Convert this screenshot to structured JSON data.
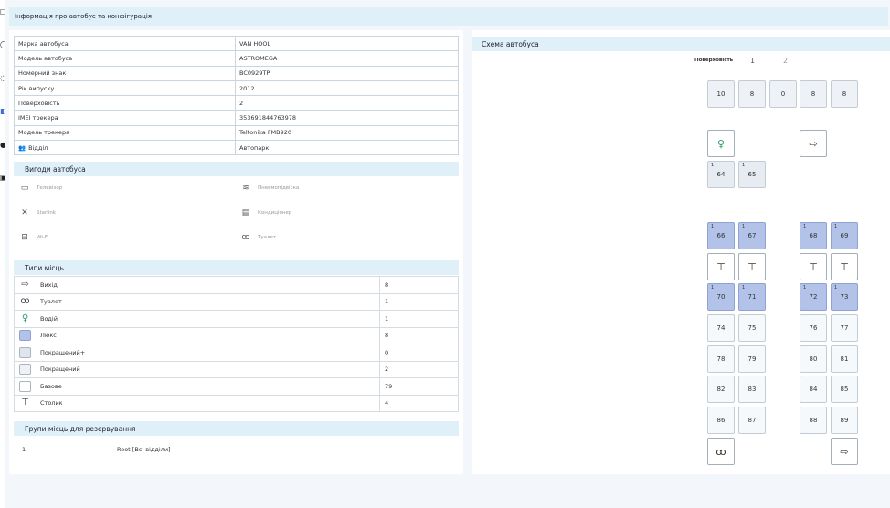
{
  "page_title": "Інформація про автобус та конфігурація",
  "left_strip_icons": [
    "phone-icon",
    "clock-icon",
    "pin-icon",
    "bus-icon",
    "people-icon",
    "box-icon"
  ],
  "bus_info": [
    {
      "label": "Марка автобуса",
      "value": "VAN HOOL"
    },
    {
      "label": "Модель автобуса",
      "value": "ASTROMEGA"
    },
    {
      "label": "Номерний знак",
      "value": "BC0929TP"
    },
    {
      "label": "Рік випуску",
      "value": "2012"
    },
    {
      "label": "Поверховість",
      "value": "2"
    },
    {
      "label": "IMEI трекера",
      "value": "353691844763978"
    },
    {
      "label": "Модель трекера",
      "value": "Teltonika FMB920"
    },
    {
      "label": "Відділ",
      "value": "Автопарк"
    }
  ],
  "amenities": {
    "title": "Вигоди автобуса",
    "items": [
      {
        "label": "Телевізор",
        "icon": "tv-icon"
      },
      {
        "label": "Пневмопідвіска",
        "icon": "suspension-icon"
      },
      {
        "label": "Starlink",
        "icon": "satellite-icon"
      },
      {
        "label": "Кондиціонер",
        "icon": "air-conditioner-icon"
      },
      {
        "label": "Wi-Fi",
        "icon": "wifi-router-icon"
      },
      {
        "label": "Туалет",
        "icon": "toilet-icon"
      }
    ]
  },
  "seat_types": {
    "title": "Типи місць",
    "rows": [
      {
        "label": "Вихід",
        "count": "8",
        "icon": "exit-icon"
      },
      {
        "label": "Туалет",
        "count": "1",
        "icon": "toilet-icon"
      },
      {
        "label": "Водій",
        "count": "1",
        "icon": "driver-icon"
      },
      {
        "label": "Люкс",
        "count": "8",
        "color": "#b2c2e8"
      },
      {
        "label": "Покращений+",
        "count": "0",
        "color": "#dfe5ec"
      },
      {
        "label": "Покращений",
        "count": "2",
        "color": "#eef2f6"
      },
      {
        "label": "Базове",
        "count": "79",
        "color": "#ffffff"
      },
      {
        "label": "Столик",
        "count": "4",
        "icon": "table-icon"
      }
    ]
  },
  "groups": {
    "title": "Групи місць для резервування",
    "rows": [
      {
        "id": "1",
        "name": "Root [Всі відділи]"
      }
    ]
  },
  "scheme": {
    "title": "Схема автобуса",
    "floor_label": "Поверховість",
    "floors": [
      "1",
      "2"
    ],
    "summary": [
      "10",
      "8",
      "0",
      "8",
      "8"
    ],
    "seats": {
      "s64": "64",
      "s65": "65",
      "s66": "66",
      "s67": "67",
      "s68": "68",
      "s69": "69",
      "s70": "70",
      "s71": "71",
      "s72": "72",
      "s73": "73",
      "s74": "74",
      "s75": "75",
      "s76": "76",
      "s77": "77",
      "s78": "78",
      "s79": "79",
      "s80": "80",
      "s81": "81",
      "s82": "82",
      "s83": "83",
      "s84": "84",
      "s85": "85",
      "s86": "86",
      "s87": "87",
      "s88": "88",
      "s89": "89"
    },
    "tier_label": "1"
  },
  "colors": {
    "header_bg": "#dff0f8",
    "lux": "#b2c2e8",
    "improved": "#eef2f6",
    "base": "#f6f9fb"
  }
}
